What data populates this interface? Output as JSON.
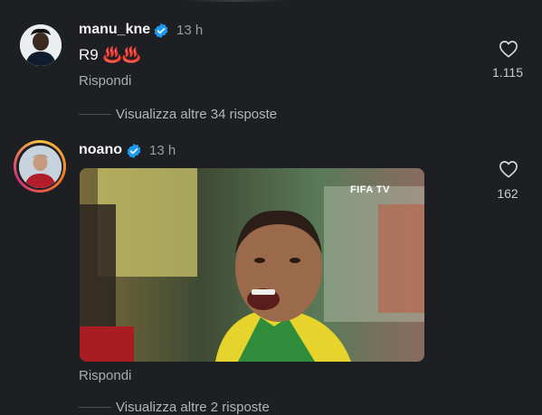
{
  "comments": [
    {
      "username": "manu_kne",
      "time": "13 h",
      "text": "R9 ♨️♨️",
      "reply_label": "Rispondi",
      "likes": "1.115",
      "view_more": "Visualizza altre 34 risposte"
    },
    {
      "username": "noano",
      "time": "13 h",
      "media_watermark": "FIFA TV",
      "reply_label": "Rispondi",
      "likes": "162",
      "view_more": "Visualizza altre 2 risposte"
    }
  ],
  "icons": {
    "verified": "verified-badge-icon",
    "like": "heart-outline-icon"
  },
  "colors": {
    "background": "#1e1f23",
    "verified": "#1d9bf0",
    "secondary_text": "#9a9ca3"
  }
}
